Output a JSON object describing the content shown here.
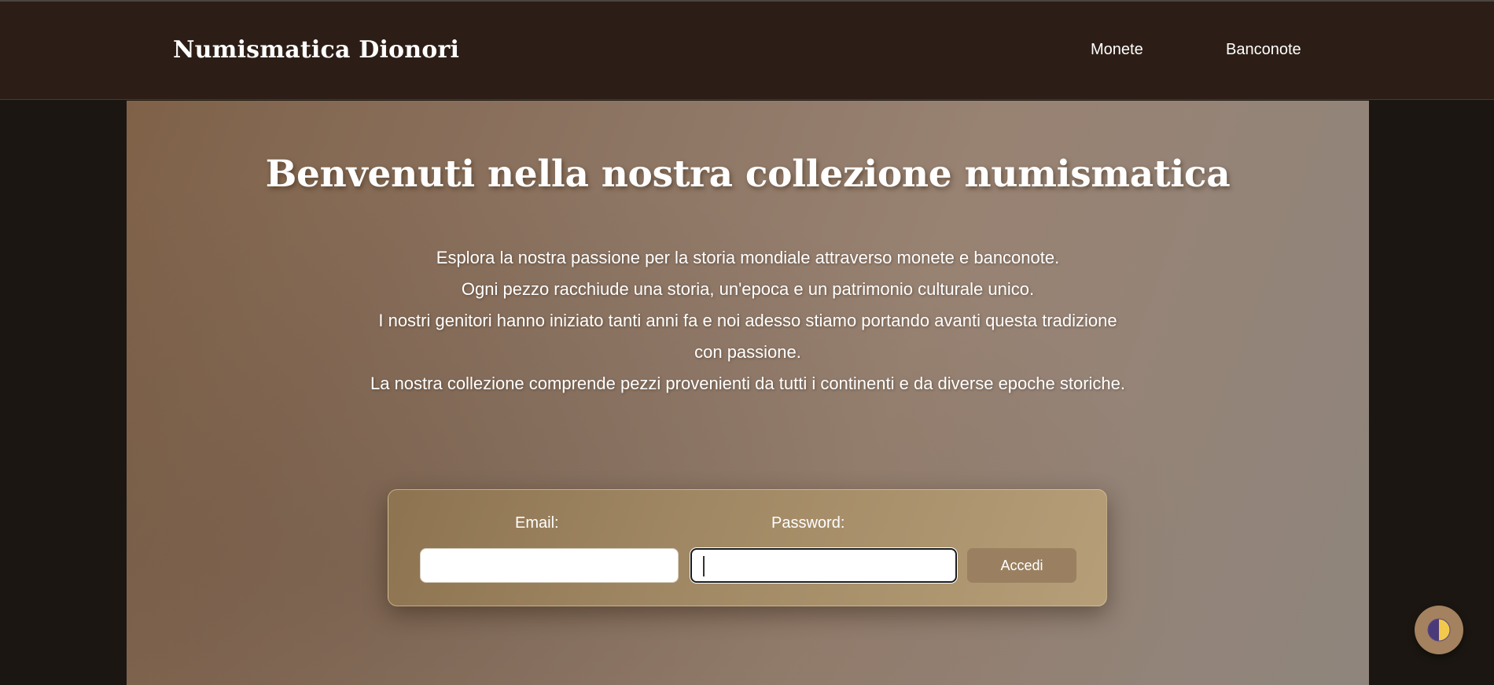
{
  "header": {
    "brand": "Numismatica Dionori",
    "nav": [
      "Monete",
      "Banconote"
    ]
  },
  "hero": {
    "title": "Benvenuti nella nostra collezione numismatica",
    "intro_lines": [
      "Esplora la nostra passione per la storia mondiale attraverso monete e banconote.",
      "Ogni pezzo racchiude una storia, un'epoca e un patrimonio culturale unico.",
      "I nostri genitori hanno iniziato tanti anni fa e noi adesso stiamo portando avanti questa tradizione con passione.",
      "La nostra collezione comprende pezzi provenienti da tutti i continenti e da diverse epoche storiche."
    ]
  },
  "login": {
    "email_label": "Email:",
    "email_value": "",
    "password_label": "Password:",
    "password_value": "",
    "submit_label": "Accedi"
  },
  "theme_toggle": {
    "icon": "half-moon-icon"
  },
  "colors": {
    "header_bg": "#2c1e16",
    "page_bg": "#1b1611",
    "button_bg": "#9a8060",
    "toggle_bg": "#a4815f"
  }
}
